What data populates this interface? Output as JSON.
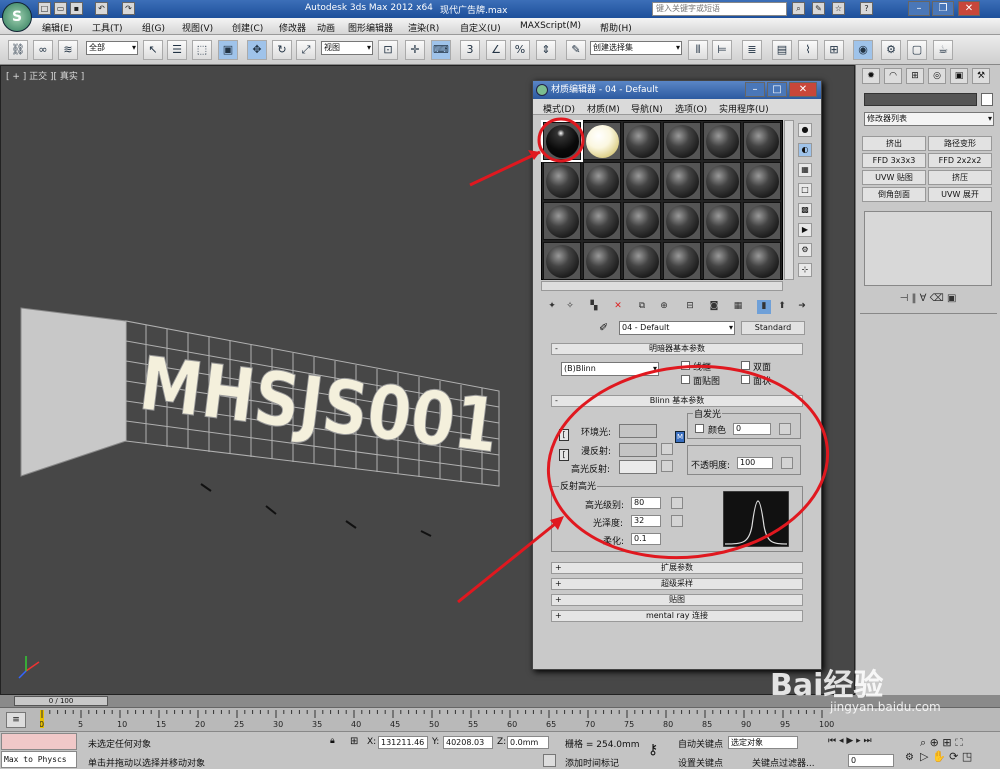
{
  "titlebar": {
    "app_title": "Autodesk 3ds Max  2012 x64",
    "file_name": "现代广告牌.max",
    "search_placeholder": "键入关键字或短语",
    "logo": "3ds Max logo"
  },
  "menubar": [
    "编辑(E)",
    "工具(T)",
    "组(G)",
    "视图(V)",
    "创建(C)",
    "修改器",
    "动画",
    "图形编辑器",
    "渲染(R)",
    "自定义(U)",
    "MAXScript(M)",
    "帮助(H)"
  ],
  "toolbar": {
    "selection_filter": "全部",
    "ref_coord": "视图",
    "named_selection": "创建选择集"
  },
  "viewport": {
    "label": "[ + ] 正交 ][ 真实 ]",
    "text3d": "MHSJS001"
  },
  "material_editor": {
    "title": "材质编辑器 - 04 - Default",
    "menu": [
      "模式(D)",
      "材质(M)",
      "导航(N)",
      "选项(O)",
      "实用程序(U)"
    ],
    "material_name": "04 - Default",
    "material_type": "Standard",
    "shader_rollout": "明暗器基本参数",
    "shader": "(B)Blinn",
    "checkboxes": [
      "线框",
      "双面",
      "面贴图",
      "面状"
    ],
    "blinn_rollout": "Blinn 基本参数",
    "self_illum": "自发光",
    "color_label": "颜色",
    "color_value": "0",
    "ambient": "环境光:",
    "diffuse": "漫反射:",
    "specular": "高光反射:",
    "opacity_label": "不透明度:",
    "opacity_value": "100",
    "spec_highlights": "反射高光",
    "spec_level_label": "高光级别:",
    "spec_level": "80",
    "glossiness_label": "光泽度:",
    "glossiness": "32",
    "soften_label": "柔化:",
    "soften": "0.1",
    "rollouts": [
      "扩展参数",
      "超级采样",
      "贴图",
      "mental ray 连接"
    ]
  },
  "command_panel": {
    "modifier_list": "修改器列表",
    "buttons": [
      "挤出",
      "路径变形",
      "FFD 3x3x3",
      "FFD 2x2x2",
      "UVW 贴图",
      "挤压",
      "倒角剖面",
      "UVW 展开"
    ]
  },
  "timeline": {
    "frame": "0 / 100",
    "ticks": [
      "0",
      "5",
      "10",
      "15",
      "20",
      "25",
      "30",
      "35",
      "40",
      "45",
      "50",
      "55",
      "60",
      "65",
      "70",
      "75",
      "80",
      "85",
      "90",
      "95",
      "100"
    ]
  },
  "status": {
    "script_box": "Max to Physcs (",
    "selection": "未选定任何对象",
    "prompt": "单击并拖动以选择并移动对象",
    "x_label": "X:",
    "x": "131211.46",
    "y_label": "Y:",
    "y": "40208.03",
    "z_label": "Z:",
    "z": "0.0mm",
    "grid": "栅格 = 254.0mm",
    "add_time_tag": "添加时间标记",
    "auto_key": "自动关键点",
    "set_key": "设置关键点",
    "selected_object": "选定对象",
    "key_filters": "关键点过滤器...",
    "frame_value": "0"
  },
  "watermark": {
    "brand": "Bai经验",
    "url": "jingyan.baidu.com"
  }
}
